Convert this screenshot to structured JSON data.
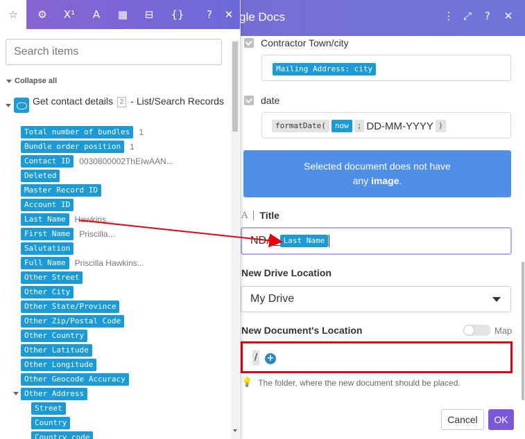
{
  "right_panel": {
    "title": "gle Docs",
    "header_icons": [
      "⋮",
      "⤢",
      "?",
      "✕"
    ],
    "contractor_label": "Contractor Town/city",
    "contractor_value_pill": "Mailing Address: city",
    "date_label": "date",
    "date_fn": "formatDate(",
    "date_now": "now",
    "date_sep": ";",
    "date_format": "DD-MM-YYYY",
    "date_close": ")",
    "notice_line1": "Selected document does not have",
    "notice_pre": "any ",
    "notice_bold": "image",
    "notice_post": ".",
    "title_label": "Title",
    "title_prefix": "NDA_",
    "title_pill": "Last Name",
    "drive_label": "New Drive Location",
    "drive_value": "My Drive",
    "docloc_label": "New Document's Location",
    "map_label": "Map",
    "slash": "/",
    "plus": "+",
    "hint": "The folder, where the new document should be placed.",
    "cancel": "Cancel",
    "ok": "OK"
  },
  "left_panel": {
    "tabs": [
      "☆",
      "⚙",
      "X¹",
      "A",
      "▦",
      "⊟",
      "{}",
      "?",
      "✕"
    ],
    "search_placeholder": "Search items",
    "collapse_all": "Collapse all",
    "module_title_pre": "Get contact details",
    "module_badge": "2",
    "module_title_post": "- List/Search Records",
    "items": [
      {
        "label": "Total number of bundles",
        "value": "1"
      },
      {
        "label": "Bundle order position",
        "value": "1"
      },
      {
        "label": "Contact ID",
        "value": "0030800002ThEIwAAN..."
      },
      {
        "label": "Deleted",
        "value": ""
      },
      {
        "label": "Master Record ID",
        "value": ""
      },
      {
        "label": "Account ID",
        "value": ""
      },
      {
        "label": "Last Name",
        "value": "Hawkins..."
      },
      {
        "label": "First Name",
        "value": "Priscilla..."
      },
      {
        "label": "Salutation",
        "value": ""
      },
      {
        "label": "Full Name",
        "value": "Priscilla Hawkins..."
      },
      {
        "label": "Other Street",
        "value": ""
      },
      {
        "label": "Other City",
        "value": ""
      },
      {
        "label": "Other State/Province",
        "value": ""
      },
      {
        "label": "Other Zip/Postal Code",
        "value": ""
      },
      {
        "label": "Other Country",
        "value": ""
      },
      {
        "label": "Other Latitude",
        "value": ""
      },
      {
        "label": "Other Longitude",
        "value": ""
      },
      {
        "label": "Other Geocode Accuracy",
        "value": ""
      },
      {
        "label": "Other Address",
        "value": ""
      }
    ],
    "sub_items": [
      "Street",
      "Country",
      "Country code"
    ]
  },
  "colors": {
    "header_purple": "#7a69d8",
    "pill_blue": "#1a9ad6",
    "notice_blue": "#4f8fe8",
    "highlight_red": "#e8000d",
    "ok_purple": "#7b59d8"
  }
}
